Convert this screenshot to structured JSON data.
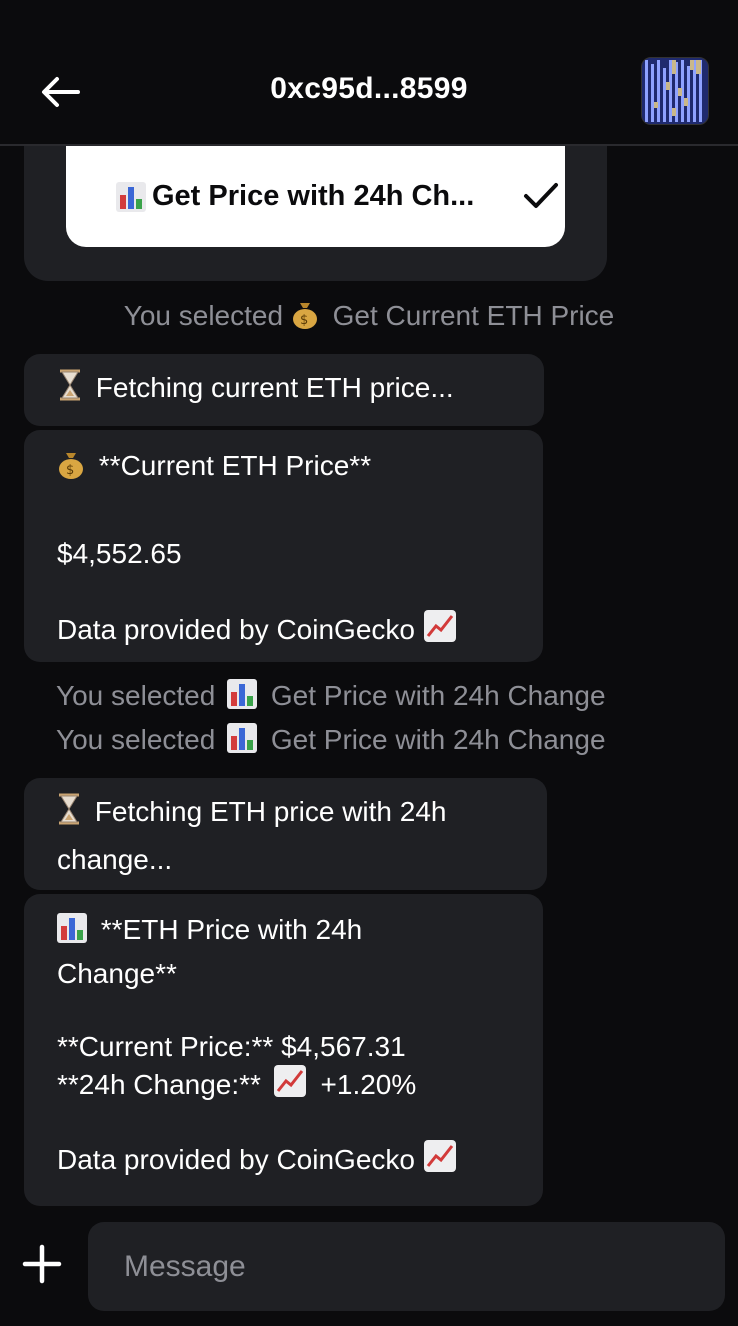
{
  "header": {
    "title": "0xc95d...8599",
    "back_icon": "arrow-left-icon",
    "avatar_icon": "avatar-pattern"
  },
  "option_card": {
    "selected_label": "Get Price with 24h Ch...",
    "icon": "bar-chart-icon",
    "check_icon": "check-icon"
  },
  "messages": {
    "sys1": "You selected",
    "sys1_item": "Get Current ETH Price",
    "fetch1": "Fetching current ETH price...",
    "price_title": "**Current ETH Price**",
    "price_value": "$4,552.65",
    "price_source": "Data provided by CoinGecko",
    "sys2": "You selected",
    "sys2_item": "Get Price with 24h Change",
    "sys3": "You selected",
    "sys3_item": "Get Price with 24h Change",
    "fetch2_line1": "Fetching ETH price with 24h",
    "fetch2_line2": "change...",
    "change_title_line1": "**ETH Price with 24h",
    "change_title_line2": "Change**",
    "current_price": "**Current Price:** $4,567.31",
    "change_label": "**24h Change:**",
    "change_value": "+1.20%",
    "change_source": "Data provided by CoinGecko"
  },
  "composer": {
    "placeholder": "Message",
    "plus_icon": "plus-icon"
  },
  "colors": {
    "background": "#0b0b0d",
    "bubble": "#1f2024",
    "muted_text": "#8e8f96"
  }
}
